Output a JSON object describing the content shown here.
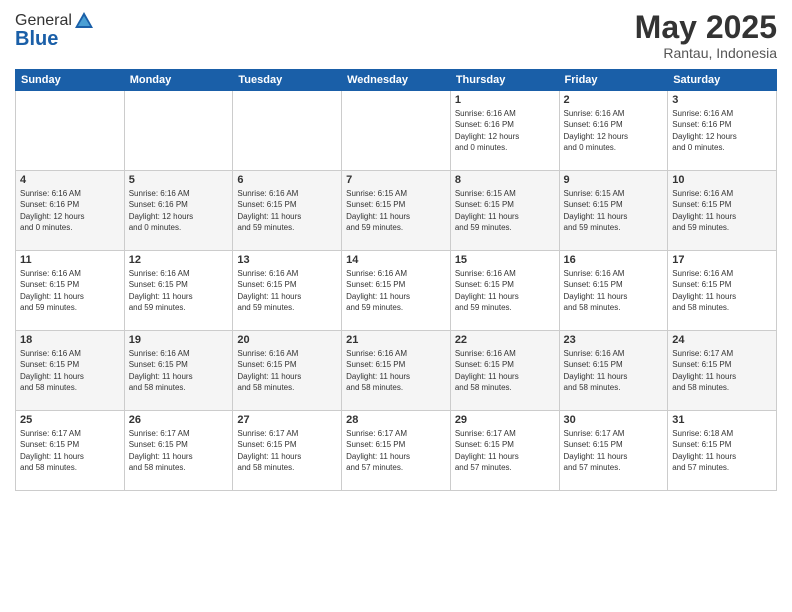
{
  "logo": {
    "general": "General",
    "blue": "Blue"
  },
  "header": {
    "title": "May 2025",
    "subtitle": "Rantau, Indonesia"
  },
  "weekdays": [
    "Sunday",
    "Monday",
    "Tuesday",
    "Wednesday",
    "Thursday",
    "Friday",
    "Saturday"
  ],
  "weeks": [
    [
      {
        "day": "",
        "info": ""
      },
      {
        "day": "",
        "info": ""
      },
      {
        "day": "",
        "info": ""
      },
      {
        "day": "",
        "info": ""
      },
      {
        "day": "1",
        "info": "Sunrise: 6:16 AM\nSunset: 6:16 PM\nDaylight: 12 hours\nand 0 minutes."
      },
      {
        "day": "2",
        "info": "Sunrise: 6:16 AM\nSunset: 6:16 PM\nDaylight: 12 hours\nand 0 minutes."
      },
      {
        "day": "3",
        "info": "Sunrise: 6:16 AM\nSunset: 6:16 PM\nDaylight: 12 hours\nand 0 minutes."
      }
    ],
    [
      {
        "day": "4",
        "info": "Sunrise: 6:16 AM\nSunset: 6:16 PM\nDaylight: 12 hours\nand 0 minutes."
      },
      {
        "day": "5",
        "info": "Sunrise: 6:16 AM\nSunset: 6:16 PM\nDaylight: 12 hours\nand 0 minutes."
      },
      {
        "day": "6",
        "info": "Sunrise: 6:16 AM\nSunset: 6:15 PM\nDaylight: 11 hours\nand 59 minutes."
      },
      {
        "day": "7",
        "info": "Sunrise: 6:15 AM\nSunset: 6:15 PM\nDaylight: 11 hours\nand 59 minutes."
      },
      {
        "day": "8",
        "info": "Sunrise: 6:15 AM\nSunset: 6:15 PM\nDaylight: 11 hours\nand 59 minutes."
      },
      {
        "day": "9",
        "info": "Sunrise: 6:15 AM\nSunset: 6:15 PM\nDaylight: 11 hours\nand 59 minutes."
      },
      {
        "day": "10",
        "info": "Sunrise: 6:16 AM\nSunset: 6:15 PM\nDaylight: 11 hours\nand 59 minutes."
      }
    ],
    [
      {
        "day": "11",
        "info": "Sunrise: 6:16 AM\nSunset: 6:15 PM\nDaylight: 11 hours\nand 59 minutes."
      },
      {
        "day": "12",
        "info": "Sunrise: 6:16 AM\nSunset: 6:15 PM\nDaylight: 11 hours\nand 59 minutes."
      },
      {
        "day": "13",
        "info": "Sunrise: 6:16 AM\nSunset: 6:15 PM\nDaylight: 11 hours\nand 59 minutes."
      },
      {
        "day": "14",
        "info": "Sunrise: 6:16 AM\nSunset: 6:15 PM\nDaylight: 11 hours\nand 59 minutes."
      },
      {
        "day": "15",
        "info": "Sunrise: 6:16 AM\nSunset: 6:15 PM\nDaylight: 11 hours\nand 59 minutes."
      },
      {
        "day": "16",
        "info": "Sunrise: 6:16 AM\nSunset: 6:15 PM\nDaylight: 11 hours\nand 58 minutes."
      },
      {
        "day": "17",
        "info": "Sunrise: 6:16 AM\nSunset: 6:15 PM\nDaylight: 11 hours\nand 58 minutes."
      }
    ],
    [
      {
        "day": "18",
        "info": "Sunrise: 6:16 AM\nSunset: 6:15 PM\nDaylight: 11 hours\nand 58 minutes."
      },
      {
        "day": "19",
        "info": "Sunrise: 6:16 AM\nSunset: 6:15 PM\nDaylight: 11 hours\nand 58 minutes."
      },
      {
        "day": "20",
        "info": "Sunrise: 6:16 AM\nSunset: 6:15 PM\nDaylight: 11 hours\nand 58 minutes."
      },
      {
        "day": "21",
        "info": "Sunrise: 6:16 AM\nSunset: 6:15 PM\nDaylight: 11 hours\nand 58 minutes."
      },
      {
        "day": "22",
        "info": "Sunrise: 6:16 AM\nSunset: 6:15 PM\nDaylight: 11 hours\nand 58 minutes."
      },
      {
        "day": "23",
        "info": "Sunrise: 6:16 AM\nSunset: 6:15 PM\nDaylight: 11 hours\nand 58 minutes."
      },
      {
        "day": "24",
        "info": "Sunrise: 6:17 AM\nSunset: 6:15 PM\nDaylight: 11 hours\nand 58 minutes."
      }
    ],
    [
      {
        "day": "25",
        "info": "Sunrise: 6:17 AM\nSunset: 6:15 PM\nDaylight: 11 hours\nand 58 minutes."
      },
      {
        "day": "26",
        "info": "Sunrise: 6:17 AM\nSunset: 6:15 PM\nDaylight: 11 hours\nand 58 minutes."
      },
      {
        "day": "27",
        "info": "Sunrise: 6:17 AM\nSunset: 6:15 PM\nDaylight: 11 hours\nand 58 minutes."
      },
      {
        "day": "28",
        "info": "Sunrise: 6:17 AM\nSunset: 6:15 PM\nDaylight: 11 hours\nand 57 minutes."
      },
      {
        "day": "29",
        "info": "Sunrise: 6:17 AM\nSunset: 6:15 PM\nDaylight: 11 hours\nand 57 minutes."
      },
      {
        "day": "30",
        "info": "Sunrise: 6:17 AM\nSunset: 6:15 PM\nDaylight: 11 hours\nand 57 minutes."
      },
      {
        "day": "31",
        "info": "Sunrise: 6:18 AM\nSunset: 6:15 PM\nDaylight: 11 hours\nand 57 minutes."
      }
    ]
  ]
}
